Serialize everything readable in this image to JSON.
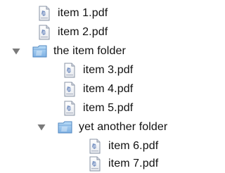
{
  "colors": {
    "text": "#111111",
    "folder_fill": "#9cc8ee",
    "folder_stroke": "#4f86bf",
    "disclosure": "#7a7a7a"
  },
  "tree": [
    {
      "name": "item 1.pdf",
      "type": "file",
      "depth": 1
    },
    {
      "name": "item 2.pdf",
      "type": "file",
      "depth": 1
    },
    {
      "name": "the item folder",
      "type": "folder",
      "expanded": true,
      "depth": 0
    },
    {
      "name": "item 3.pdf",
      "type": "file",
      "depth": 2
    },
    {
      "name": "item 4.pdf",
      "type": "file",
      "depth": 2
    },
    {
      "name": "item 5.pdf",
      "type": "file",
      "depth": 2
    },
    {
      "name": "yet another folder",
      "type": "folder",
      "expanded": true,
      "depth": 1
    },
    {
      "name": "item 6.pdf",
      "type": "file",
      "depth": 3
    },
    {
      "name": "item 7.pdf",
      "type": "file",
      "depth": 3
    }
  ]
}
